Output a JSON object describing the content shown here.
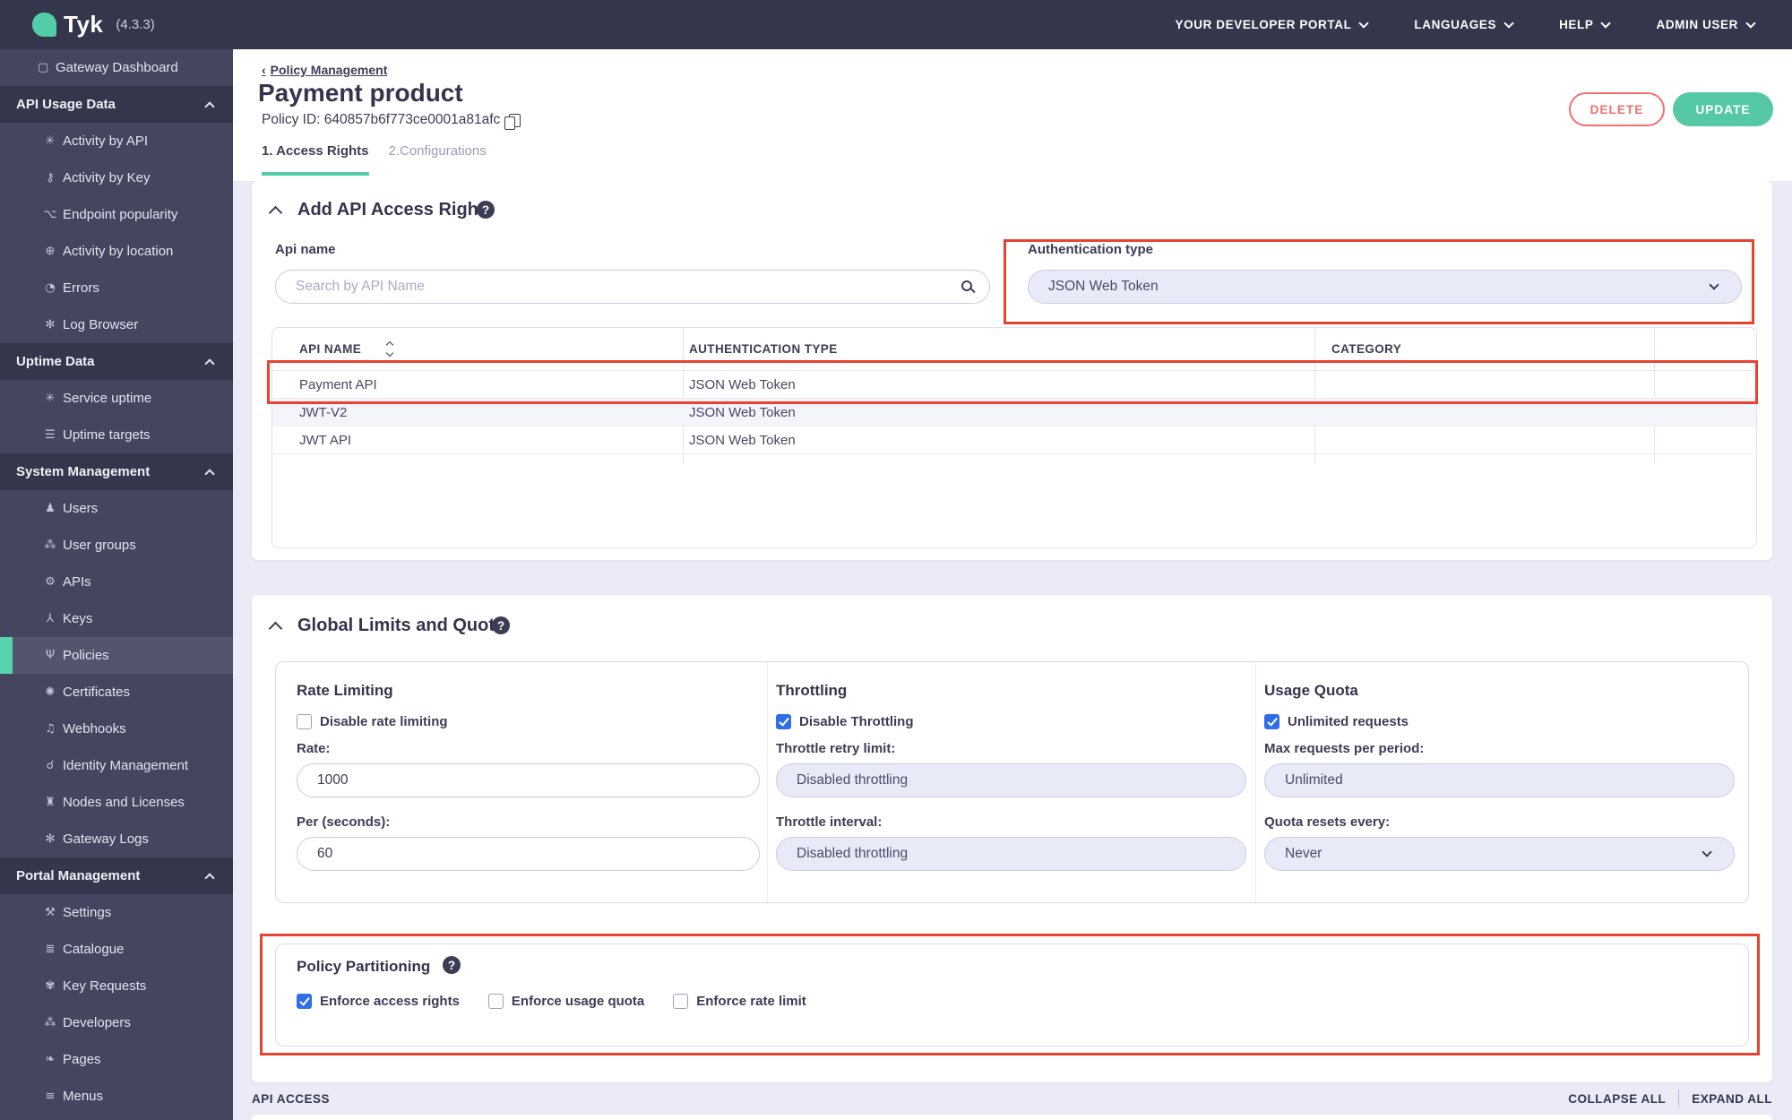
{
  "topbar": {
    "brand": "Tyk",
    "version": "(4.3.3)",
    "nav": [
      {
        "label": "YOUR DEVELOPER PORTAL"
      },
      {
        "label": "LANGUAGES"
      },
      {
        "label": "HELP"
      },
      {
        "label": "ADMIN USER"
      }
    ]
  },
  "sidebar": {
    "items": [
      {
        "type": "item",
        "label": "Gateway Dashboard",
        "icon": "monitor-icon",
        "glyph": "▢",
        "active": false
      },
      {
        "type": "section",
        "label": "API Usage Data"
      },
      {
        "type": "item",
        "label": "Activity by API",
        "icon": "activity-icon",
        "glyph": "✳",
        "active": false
      },
      {
        "type": "item",
        "label": "Activity by Key",
        "icon": "key-icon",
        "glyph": "⚷",
        "active": false
      },
      {
        "type": "item",
        "label": "Endpoint popularity",
        "icon": "branch-icon",
        "glyph": "⌥",
        "active": false
      },
      {
        "type": "item",
        "label": "Activity by location",
        "icon": "globe-icon",
        "glyph": "⊕",
        "active": false
      },
      {
        "type": "item",
        "label": "Errors",
        "icon": "bomb-icon",
        "glyph": "◔",
        "active": false
      },
      {
        "type": "item",
        "label": "Log Browser",
        "icon": "bug-icon",
        "glyph": "✻",
        "active": false
      },
      {
        "type": "section",
        "label": "Uptime Data"
      },
      {
        "type": "item",
        "label": "Service uptime",
        "icon": "uptime-icon",
        "glyph": "✳",
        "active": false
      },
      {
        "type": "item",
        "label": "Uptime targets",
        "icon": "list-icon",
        "glyph": "☰",
        "active": false
      },
      {
        "type": "section",
        "label": "System Management"
      },
      {
        "type": "item",
        "label": "Users",
        "icon": "user-icon",
        "glyph": "♟",
        "active": false
      },
      {
        "type": "item",
        "label": "User groups",
        "icon": "user-group-icon",
        "glyph": "⁂",
        "active": false
      },
      {
        "type": "item",
        "label": "APIs",
        "icon": "gears-icon",
        "glyph": "⚙",
        "active": false
      },
      {
        "type": "item",
        "label": "Keys",
        "icon": "share-icon",
        "glyph": "⅄",
        "active": false
      },
      {
        "type": "item",
        "label": "Policies",
        "icon": "plug-icon",
        "glyph": "Ψ",
        "active": true
      },
      {
        "type": "item",
        "label": "Certificates",
        "icon": "medal-icon",
        "glyph": "✺",
        "active": false
      },
      {
        "type": "item",
        "label": "Webhooks",
        "icon": "bell-icon",
        "glyph": "♫",
        "active": false
      },
      {
        "type": "item",
        "label": "Identity Management",
        "icon": "link-icon",
        "glyph": "☌",
        "active": false
      },
      {
        "type": "item",
        "label": "Nodes and Licenses",
        "icon": "building-icon",
        "glyph": "♜",
        "active": false
      },
      {
        "type": "item",
        "label": "Gateway Logs",
        "icon": "bug-icon",
        "glyph": "✻",
        "active": false
      },
      {
        "type": "section",
        "label": "Portal Management"
      },
      {
        "type": "item",
        "label": "Settings",
        "icon": "wrench-icon",
        "glyph": "⚒",
        "active": false
      },
      {
        "type": "item",
        "label": "Catalogue",
        "icon": "layers-icon",
        "glyph": "≣",
        "active": false
      },
      {
        "type": "item",
        "label": "Key Requests",
        "icon": "paw-icon",
        "glyph": "✾",
        "active": false
      },
      {
        "type": "item",
        "label": "Developers",
        "icon": "users-icon",
        "glyph": "⁂",
        "active": false
      },
      {
        "type": "item",
        "label": "Pages",
        "icon": "leaf-icon",
        "glyph": "❧",
        "active": false
      },
      {
        "type": "item",
        "label": "Menus",
        "icon": "menu-icon",
        "glyph": "≡",
        "active": false
      }
    ]
  },
  "page": {
    "breadcrumb_chevron": "‹",
    "breadcrumb": "Policy Management",
    "title": "Payment product",
    "policy_id_full": "Policy ID: 640857b6f773ce0001a81afc",
    "tabs": [
      {
        "label": "1. Access Rights",
        "active": true
      },
      {
        "label": "2.Configurations",
        "active": false
      }
    ],
    "actions": {
      "delete": "DELETE",
      "update": "UPDATE"
    }
  },
  "access_rights": {
    "title": "Add API Access Rights",
    "api_name_label": "Api name",
    "search_placeholder": "Search by API Name",
    "auth_type_label": "Authentication type",
    "auth_type_value": "JSON Web Token",
    "table": {
      "columns": [
        "API NAME",
        "AUTHENTICATION TYPE",
        "CATEGORY"
      ],
      "rows": [
        {
          "api_name": "Payment API",
          "auth_type": "JSON Web Token",
          "category": "",
          "annotated": true
        },
        {
          "api_name": "JWT-V2",
          "auth_type": "JSON Web Token",
          "category": "",
          "annotated": false
        },
        {
          "api_name": "JWT API",
          "auth_type": "JSON Web Token",
          "category": "",
          "annotated": false
        }
      ]
    }
  },
  "global_limits": {
    "title": "Global Limits and Quota",
    "rate_limiting": {
      "title": "Rate Limiting",
      "checkbox_label": "Disable rate limiting",
      "checkbox_checked": false,
      "rate_label": "Rate:",
      "rate_value": "1000",
      "per_label": "Per (seconds):",
      "per_value": "60"
    },
    "throttling": {
      "title": "Throttling",
      "checkbox_label": "Disable Throttling",
      "checkbox_checked": true,
      "retry_label": "Throttle retry limit:",
      "retry_value": "Disabled throttling",
      "interval_label": "Throttle interval:",
      "interval_value": "Disabled throttling"
    },
    "usage_quota": {
      "title": "Usage Quota",
      "checkbox_label": "Unlimited requests",
      "checkbox_checked": true,
      "max_label": "Max requests per period:",
      "max_value": "Unlimited",
      "resets_label": "Quota resets every:",
      "resets_value": "Never"
    }
  },
  "policy_partitioning": {
    "title": "Policy Partitioning",
    "checkboxes": [
      {
        "label": "Enforce access rights",
        "checked": true
      },
      {
        "label": "Enforce usage quota",
        "checked": false
      },
      {
        "label": "Enforce rate limit",
        "checked": false
      }
    ]
  },
  "footer": {
    "section": "API ACCESS",
    "collapse_all": "COLLAPSE ALL",
    "expand_all": "EXPAND ALL"
  },
  "colors": {
    "teal": "#55c9a6",
    "annotation_red": "#e8432e",
    "delete_red": "#f16f6f",
    "checkbox_blue": "#2e6fe8",
    "sidebar_dark": "#34364b",
    "sidebar_base": "#44465f"
  }
}
